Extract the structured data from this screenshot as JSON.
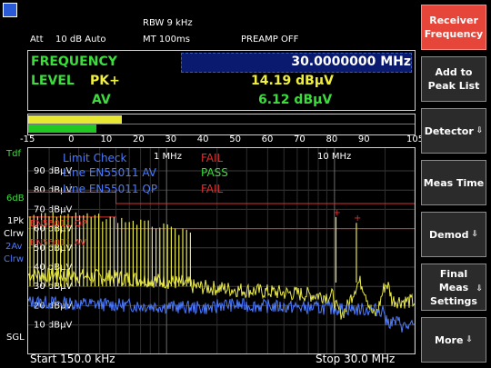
{
  "header": {
    "rbw": "RBW 9 kHz",
    "att_label": "Att",
    "att_value": "10 dB Auto",
    "mt": "MT  100ms",
    "preamp": "PREAMP OFF"
  },
  "info": {
    "frequency_label": "FREQUENCY",
    "frequency_value": "30.0000000 MHz",
    "level_label": "LEVEL",
    "pk_label": "PK+",
    "pk_value": "14.19 dBμV",
    "av_label": "AV",
    "av_value": "6.12 dBμV"
  },
  "bar": {
    "pk_level": 14.19,
    "av_level": 6.12,
    "scale_min": -15,
    "scale_max": 105,
    "ticks": [
      "-15",
      "0",
      "10",
      "20",
      "30",
      "40",
      "50",
      "60",
      "70",
      "80",
      "90",
      "105"
    ]
  },
  "left_labels": {
    "tdf": "Tdf",
    "six_db": "6dB",
    "pk1": "1Pk",
    "clrw1": "Clrw",
    "av2": "2Av",
    "clrw2": "Clrw",
    "sgl": "SGL"
  },
  "graph": {
    "freq_markers": [
      "1 MHz",
      "10 MHz"
    ],
    "ylabels": [
      "90 dBμV",
      "80 dBμV",
      "70 dBμV",
      "60 dBμV",
      "50 dBμV",
      "40 dBμV",
      "30 dBμV",
      "20 dBμV",
      "10 dBμV"
    ],
    "limit_lines": [
      "EN55011 QP",
      "EN55011 AV"
    ],
    "limit_check": [
      {
        "label": "Limit Check",
        "result": "FAIL"
      },
      {
        "label": "Line EN55011 AV",
        "result": "PASS"
      },
      {
        "label": "Line EN55011 QP",
        "result": "FAIL"
      }
    ]
  },
  "softkeys": [
    {
      "label": "Receiver Frequency",
      "arrow": false
    },
    {
      "label": "Add to Peak List",
      "arrow": false
    },
    {
      "label": "Detector",
      "arrow": true
    },
    {
      "label": "Meas Time",
      "arrow": false
    },
    {
      "label": "Demod",
      "arrow": true
    },
    {
      "label": "Final Meas Settings",
      "arrow": true
    },
    {
      "label": "More",
      "arrow": true
    }
  ],
  "footer": {
    "start": "Start 150.0 kHz",
    "stop": "Stop 30.0 MHz"
  },
  "colors": {
    "pk_trace": "#e8e84a",
    "av_trace": "#4a7aff",
    "limit": "#e03030",
    "softkey_selected": "#e6453a"
  }
}
